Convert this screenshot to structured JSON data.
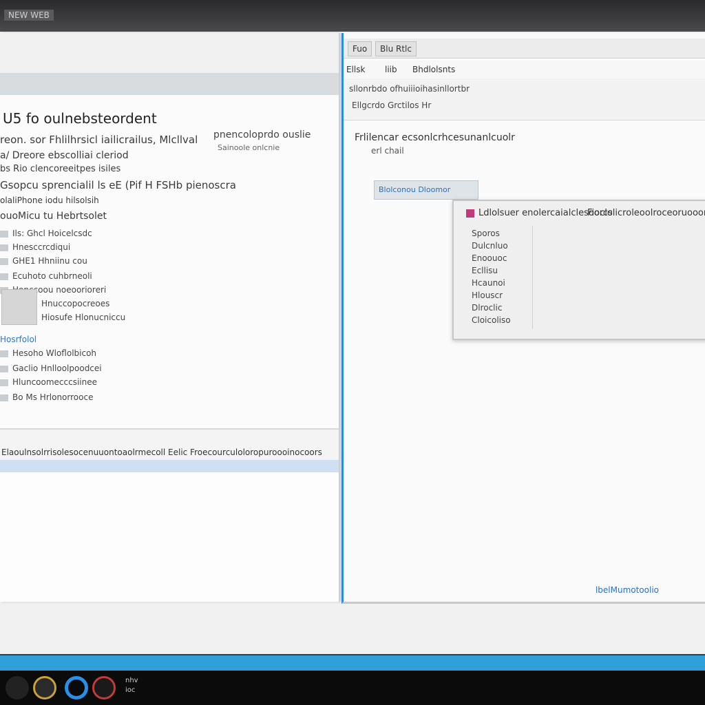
{
  "desktop": {
    "title": "NEW WEB"
  },
  "left_window": {
    "doc_title": "U5 fo oulnebsteordent",
    "lines": [
      "reon. sor Fhlilhrsicl iailicrailus, Mlcllval",
      "a/ Dreore ebscolliai cleriod",
      "bs Rio clencoreeitpes isiles",
      "Gsopcu sprencialil ls eE (Pif H FSHb pienoscra",
      "olaliPhone iodu hilsolsih",
      "ouoMicu tu Hebrtsolet"
    ],
    "side_note": "pnencoloprdo ouslie",
    "side_note_sub": "Sainoole onlcnie",
    "list": [
      "Ils: Ghcl  Hoicelcsdc",
      "Hnesccrcdiqui",
      "GHE1  Hhniinu cou",
      "Ecuhoto  cuhbrneoli",
      "Honccoou noeoorioreri",
      "Hnuccopocreoes",
      "Hiosufe  Hlonucniccu",
      "Hesoho  Wloflolbicoh",
      "Gaclio  Hnlloolpoodcei",
      "Hluncoomecccsiinee",
      "Bo Ms  Hrlonorrooce"
    ],
    "list_link": "Hosrfolol",
    "status_text": "Elaoulnsolrrisolesocenuuontoaolrmecoll Eelic  Froecourculoloropuroooinocoors"
  },
  "right_window": {
    "tabs": [
      "Fuo",
      "Blu Rtlc"
    ],
    "menu": [
      "Ellsk",
      "liib",
      "Bhdlolsnts"
    ],
    "ribbon": [
      "sllonrbdo ofhuiiioihasinllortbr",
      "Ellgcrdo Grctilos Hr"
    ],
    "heading": "Frlilencar ecsonlcrhcesunanlcuolr",
    "sub": "erl chail",
    "field": "Blolconou Dloomor",
    "dialog_title": "Ldlolsuer  enolercaialclesoorcs",
    "dialog_title2": "Fioclolicroleoolroceoruoooreoe",
    "dialog_rows": [
      "Sporos",
      "Dulcnluo",
      "Enoouoc",
      "Ecllisu",
      "Hcaunoi",
      "Hlouscr",
      "Dlroclic",
      "Cloicoliso"
    ],
    "footer_link": "lbelMumotoolio"
  },
  "taskbar": {
    "text_line1": "nhv",
    "text_line2": "ioc"
  },
  "colors": {
    "accent": "#2f9fd8",
    "link": "#2a78c8"
  }
}
